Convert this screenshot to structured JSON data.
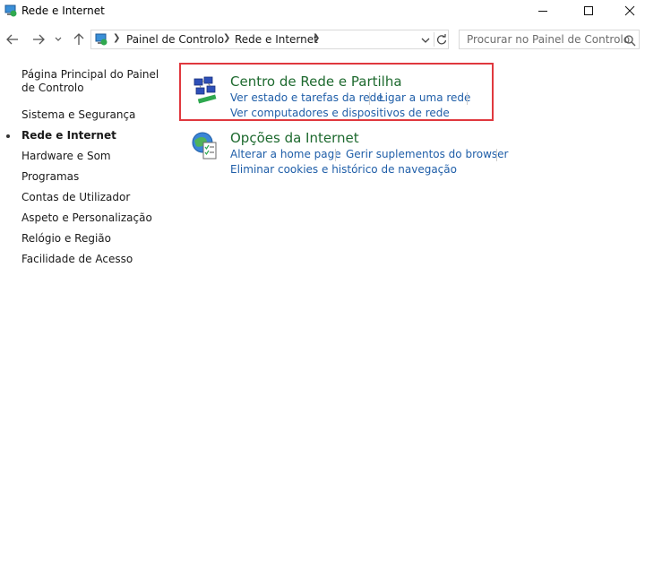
{
  "window": {
    "title": "Rede e Internet",
    "accent": "#e0383e"
  },
  "address": {
    "crumbs": [
      "Painel de Controlo",
      "Rede e Internet"
    ],
    "search_placeholder": "Procurar no Painel de Controlo"
  },
  "sidebar": {
    "items": [
      {
        "label": "Página Principal do Painel de Controlo"
      },
      {
        "label": "Sistema e Segurança"
      },
      {
        "label": "Rede e Internet",
        "current": true
      },
      {
        "label": "Hardware e Som"
      },
      {
        "label": "Programas"
      },
      {
        "label": "Contas de Utilizador"
      },
      {
        "label": "Aspeto e Personalização"
      },
      {
        "label": "Relógio e Região"
      },
      {
        "label": "Facilidade de Acesso"
      }
    ]
  },
  "categories": [
    {
      "title": "Centro de Rede e Partilha",
      "icon": "network-center-icon",
      "links": [
        "Ver estado e tarefas da rede",
        "Ligar a uma rede",
        "Ver computadores e dispositivos de rede"
      ]
    },
    {
      "title": "Opções da Internet",
      "icon": "internet-options-icon",
      "links": [
        "Alterar a home page",
        "Gerir suplementos do browser",
        "Eliminar cookies e histórico de navegação"
      ]
    }
  ]
}
